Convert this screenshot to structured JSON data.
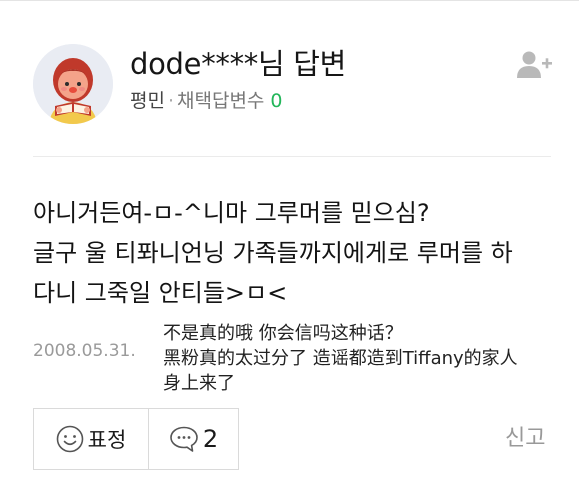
{
  "profile": {
    "username": "dode****님 답변",
    "rank": "평민",
    "separator": "·",
    "adopt_label": "채택답변수",
    "adopt_count": "0"
  },
  "answer": {
    "lines": [
      "아니거든여-ㅁ-^니마 그루머를 믿으심?",
      "글구 울 티퐈니언닝 가족들까지에게로 루머를 하",
      "다니 그죽일 안티들>ㅁ<"
    ],
    "date": "2008.05.31."
  },
  "caption": {
    "lines": [
      "不是真的哦 你会信吗这种话？",
      "黑粉真的太过分了 造谣都造到Tiffany的家人",
      "身上来了"
    ]
  },
  "actions": {
    "emote_label": "표정",
    "comment_count": "2",
    "report_label": "신고"
  },
  "icons": {
    "avatar": "reading-character-avatar",
    "add_friend": "add-person-icon",
    "emote": "smiley-icon",
    "comment": "speech-bubble-icon"
  },
  "colors": {
    "accent_green": "#23b65a",
    "muted_text": "#999999",
    "border": "#dadada"
  }
}
